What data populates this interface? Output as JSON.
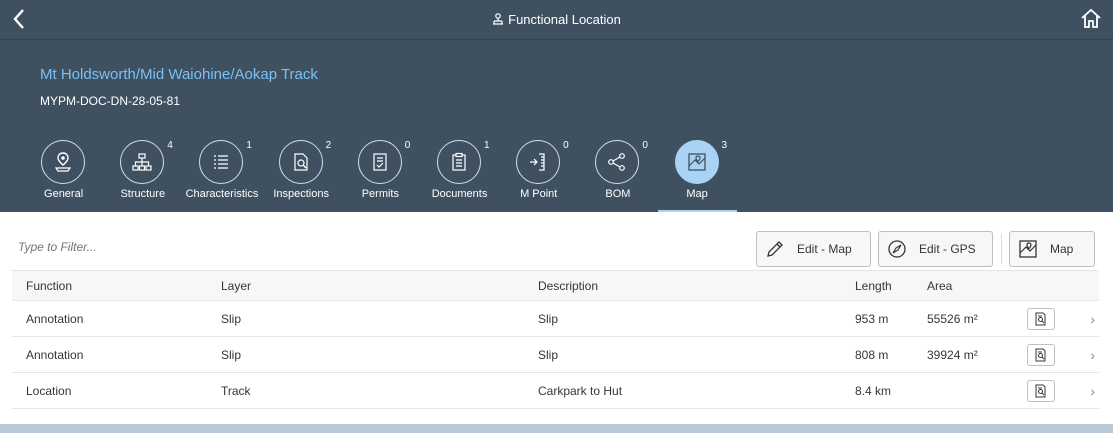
{
  "topbar": {
    "title": "Functional Location",
    "back_icon": "chevron-left-icon",
    "home_icon": "home-icon",
    "title_icon": "functional-location-icon"
  },
  "header": {
    "title": "Mt Holdsworth/Mid Waiohine/Aokap Track",
    "id": "MYPM-DOC-DN-28-05-81"
  },
  "tabs": [
    {
      "label": "General",
      "count": "",
      "icon": "location-pin-icon"
    },
    {
      "label": "Structure",
      "count": "4",
      "icon": "hierarchy-icon"
    },
    {
      "label": "Characteristics",
      "count": "1",
      "icon": "list-icon"
    },
    {
      "label": "Inspections",
      "count": "2",
      "icon": "inspection-icon"
    },
    {
      "label": "Permits",
      "count": "0",
      "icon": "permit-icon"
    },
    {
      "label": "Documents",
      "count": "1",
      "icon": "clipboard-icon"
    },
    {
      "label": "M Point",
      "count": "0",
      "icon": "measure-point-icon"
    },
    {
      "label": "BOM",
      "count": "0",
      "icon": "share-icon"
    },
    {
      "label": "Map",
      "count": "3",
      "icon": "map-icon",
      "active": true
    }
  ],
  "filter": {
    "placeholder": "Type to Filter..."
  },
  "toolbar": {
    "edit_map": "Edit - Map",
    "edit_gps": "Edit - GPS",
    "map": "Map"
  },
  "table": {
    "headers": {
      "function": "Function",
      "layer": "Layer",
      "description": "Description",
      "length": "Length",
      "area": "Area"
    },
    "rows": [
      {
        "function": "Annotation",
        "layer": "Slip",
        "description": "Slip",
        "length": "953 m",
        "area": "55526 m²"
      },
      {
        "function": "Annotation",
        "layer": "Slip",
        "description": "Slip",
        "length": "808 m",
        "area": "39924 m²"
      },
      {
        "function": "Location",
        "layer": "Track",
        "description": "Carkpark to Hut",
        "length": "8.4 km",
        "area": ""
      }
    ]
  },
  "colors": {
    "shell": "#3f5161",
    "accent": "#79c0f4",
    "active_tab": "#a8d3f5"
  }
}
